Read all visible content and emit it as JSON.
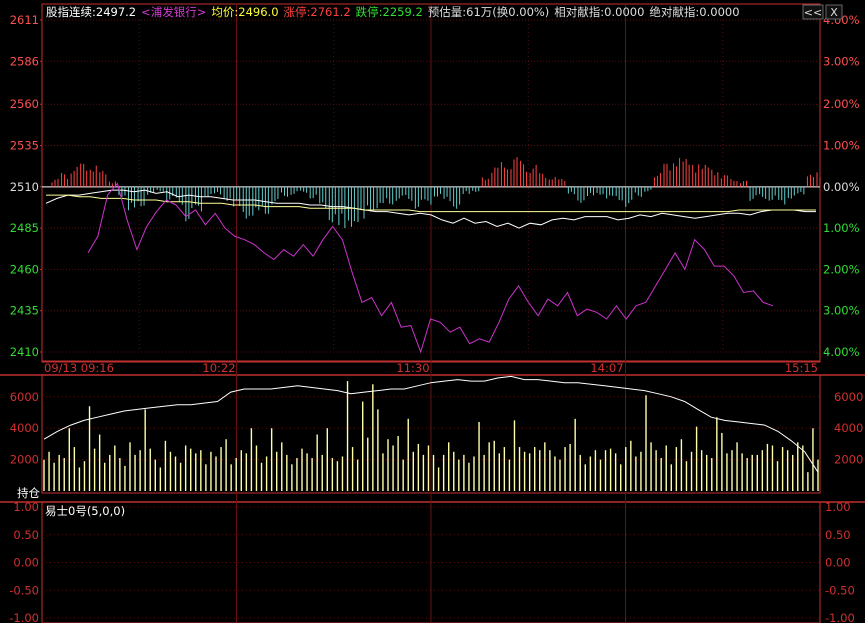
{
  "header": {
    "items": [
      {
        "text": "股指连续:2497.2",
        "color": "#ffffff"
      },
      {
        "text": "<浦发银行>",
        "color": "#d03bd0"
      },
      {
        "text": "均价:2496.0",
        "color": "#ffff33"
      },
      {
        "text": "涨停:2761.2",
        "color": "#ff4040"
      },
      {
        "text": "跌停:2259.2",
        "color": "#33dd33"
      },
      {
        "text": "预估量:61万(换0.00%)",
        "color": "#dddddd"
      },
      {
        "text": "相对献指:0.0000",
        "color": "#dddddd"
      },
      {
        "text": "绝对献指:0.0000",
        "color": "#dddddd"
      }
    ],
    "btn_collapse": "<<",
    "btn_close": "X"
  },
  "indicator": {
    "label": "易士0号(5,0,0)"
  },
  "volume": {
    "label": "持仓"
  },
  "colors": {
    "axis_red": "#c03030",
    "grid_red": "#5a0d0d",
    "price_white": "#ffffff",
    "avg_yellow": "#ffff99",
    "magenta": "#cc33cc",
    "bar_up": "#ff4545",
    "bar_down": "#66cccc",
    "vol_bar": "#ffffaa",
    "green_label": "#33dd33"
  },
  "chart_data": [
    {
      "type": "line",
      "panel": "price",
      "y_left_ticks": [
        "2611",
        "2586",
        "2560",
        "2535",
        "2510",
        "2485",
        "2460",
        "2435",
        "2410"
      ],
      "y_left_values": [
        2611,
        2586,
        2560,
        2535,
        2510,
        2485,
        2460,
        2435,
        2410
      ],
      "y_right_ticks": [
        "4.00%",
        "3.00%",
        "2.00%",
        "1.00%",
        "0.00%",
        "1.00%",
        "2.00%",
        "3.00%",
        "4.00%"
      ],
      "ylim": [
        2410,
        2611
      ],
      "baseline": 2510,
      "x_labels": [
        "09/13 09:16",
        "10:22",
        "11:30",
        "14:07",
        "15:15"
      ],
      "x_positions": [
        0,
        0.25,
        0.5,
        0.75,
        1
      ],
      "series": [
        {
          "key": "price",
          "color": "#ffffff",
          "values": [
            2500,
            2503,
            2505,
            2505,
            2506,
            2507,
            2508,
            2508,
            2507,
            2508,
            2506,
            2507,
            2504,
            2505,
            2504,
            2504,
            2503,
            2502,
            2502,
            2502,
            2501,
            2500,
            2500,
            2500,
            2499,
            2499,
            2498,
            2498,
            2497,
            2496,
            2495,
            2495,
            2494,
            2493,
            2494,
            2493,
            2490,
            2488,
            2491,
            2488,
            2489,
            2486,
            2488,
            2485,
            2488,
            2487,
            2490,
            2491,
            2490,
            2492,
            2492,
            2492,
            2490,
            2491,
            2493,
            2492,
            2494,
            2493,
            2492,
            2491,
            2492,
            2493,
            2494,
            2494,
            2493,
            2495,
            2496,
            2496,
            2496,
            2495,
            2495
          ]
        },
        {
          "key": "avg",
          "color": "#ffff99",
          "values": [
            2505,
            2505,
            2505,
            2504,
            2504,
            2503,
            2503,
            2503,
            2502,
            2502,
            2502,
            2501,
            2501,
            2501,
            2500,
            2500,
            2500,
            2499,
            2499,
            2499,
            2498,
            2498,
            2498,
            2498,
            2497,
            2497,
            2497,
            2497,
            2497,
            2496,
            2496,
            2496,
            2496,
            2496,
            2495,
            2495,
            2495,
            2495,
            2495,
            2495,
            2495,
            2495,
            2495,
            2495,
            2495,
            2495,
            2495,
            2495,
            2495,
            2495,
            2495,
            2495,
            2495,
            2495,
            2495,
            2495,
            2495,
            2495,
            2495,
            2495,
            2495,
            2495,
            2495,
            2496,
            2496,
            2496,
            2496,
            2496,
            2496,
            2496,
            2496
          ]
        },
        {
          "key": "related",
          "color": "#cc33cc",
          "values": [
            2470,
            2480,
            2505,
            2512,
            2490,
            2472,
            2486,
            2495,
            2502,
            2499,
            2492,
            2496,
            2487,
            2494,
            2485,
            2480,
            2478,
            2475,
            2470,
            2466,
            2472,
            2468,
            2475,
            2468,
            2478,
            2486,
            2478,
            2458,
            2440,
            2443,
            2432,
            2440,
            2425,
            2426,
            2410,
            2430,
            2428,
            2422,
            2425,
            2415,
            2418,
            2416,
            2428,
            2442,
            2450,
            2440,
            2432,
            2442,
            2438,
            2446,
            2432,
            2436,
            2434,
            2430,
            2438,
            2430,
            2438,
            2440,
            2450,
            2460,
            2470,
            2460,
            2478,
            2472,
            2462,
            2462,
            2456,
            2446,
            2447,
            2440,
            2438
          ]
        }
      ],
      "diff_bars": [
        8,
        14,
        20,
        24,
        22,
        16,
        6,
        -10,
        -25,
        -20,
        -8,
        -5,
        -15,
        -18,
        -35,
        -25,
        -10,
        -8,
        -14,
        -22,
        -32,
        -30,
        -28,
        -18,
        -10,
        -8,
        -6,
        -12,
        -22,
        -36,
        -45,
        -40,
        -38,
        -25,
        -22,
        -18,
        -14,
        -14,
        -22,
        -18,
        -10,
        -15,
        -22,
        -8,
        -5,
        10,
        20,
        25,
        30,
        26,
        22,
        14,
        10,
        8,
        -8,
        -16,
        -10,
        -8,
        -12,
        -14,
        -20,
        -10,
        -5,
        14,
        24,
        30,
        28,
        25,
        22,
        18,
        12,
        8,
        6,
        -14,
        -12,
        -14,
        -18,
        -12,
        -8,
        12,
        16
      ]
    },
    {
      "type": "bar",
      "panel": "volume",
      "y_left_ticks": [
        "6000",
        "4000",
        "2000"
      ],
      "y_left_values": [
        6000,
        4000,
        2000
      ],
      "y_right_ticks": [
        "6000",
        "4000",
        "2000"
      ],
      "ylim": [
        0,
        7200
      ],
      "series": [
        {
          "key": "open_interest",
          "color": "#ffffff",
          "values": [
            3300,
            3800,
            4200,
            4500,
            4700,
            4900,
            5100,
            5200,
            5300,
            5400,
            5500,
            5500,
            5600,
            5700,
            6300,
            6500,
            6500,
            6500,
            6600,
            6700,
            6600,
            6500,
            6400,
            6200,
            6300,
            6400,
            6500,
            6500,
            6700,
            6900,
            7000,
            7100,
            7000,
            7000,
            7200,
            7300,
            7100,
            7100,
            7000,
            6900,
            6900,
            6800,
            6700,
            6600,
            6500,
            6400,
            6200,
            6000,
            5700,
            5200,
            4700,
            4500,
            4400,
            4300,
            4200,
            3800,
            3200,
            2500,
            1200
          ]
        }
      ],
      "bars": [
        2000,
        2500,
        1800,
        2300,
        2100,
        4000,
        2800,
        1500,
        1900,
        5400,
        2700,
        3600,
        1800,
        2300,
        2900,
        2100,
        1600,
        3100,
        2300,
        2600,
        5200,
        2700,
        2000,
        1500,
        3200,
        2500,
        2200,
        1800,
        2900,
        2700,
        2400,
        2600,
        1700,
        2500,
        2200,
        2800,
        3300,
        1700,
        2100,
        2600,
        2400,
        4000,
        2900,
        1800,
        2200,
        4000,
        2500,
        3100,
        2300,
        1700,
        2100,
        2700,
        2400,
        2100,
        3600,
        2300,
        4000,
        2100,
        1900,
        2200,
        7000,
        2800,
        2000,
        5700,
        3400,
        6800,
        5200,
        2400,
        3300,
        2900,
        3500,
        2000,
        4600,
        2500,
        3000,
        2300,
        2900,
        2300,
        1500,
        2300,
        3100,
        2500,
        2000,
        2300,
        1800,
        2200,
        4400,
        2300,
        3100,
        3200,
        2400,
        2800,
        2000,
        4500,
        2800,
        2500,
        2400,
        2800,
        2600,
        3100,
        2600,
        2200,
        2000,
        2800,
        3000,
        4600,
        2300,
        1700,
        2200,
        2600,
        2000,
        2600,
        2700,
        2400,
        1700,
        2800,
        3200,
        2200,
        2500,
        6100,
        3100,
        2600,
        2100,
        2900,
        1700,
        2800,
        3300,
        1900,
        2500,
        4100,
        2600,
        2300,
        2100,
        4700,
        3700,
        2400,
        2600,
        3100,
        2400,
        2100,
        2300,
        2300,
        2600,
        3000,
        2900,
        1900,
        2800,
        2600,
        2300,
        3100,
        2900,
        1200,
        4000,
        2000
      ]
    },
    {
      "type": "line",
      "panel": "indicator",
      "y_left_ticks": [
        "1.00",
        "0.50",
        "0.00",
        "-0.50",
        "-1.00"
      ],
      "y_left_values": [
        1.0,
        0.5,
        0.0,
        -0.5,
        -1.0
      ],
      "y_right_ticks": [
        "1.00",
        "0.50",
        "0.00",
        "-0.50",
        "-1.00"
      ],
      "ylim": [
        -1.0,
        1.0
      ]
    }
  ]
}
